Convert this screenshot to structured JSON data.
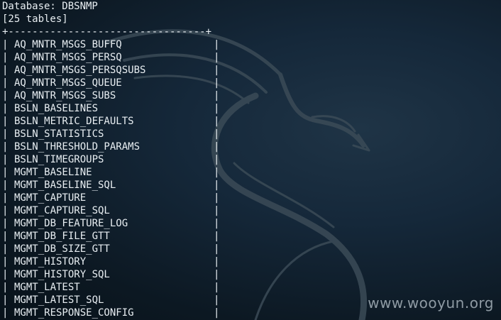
{
  "terminal": {
    "database_line": "Database: DBSNMP",
    "table_count_line": "[25 tables]",
    "border_top": "+---------------------------------+",
    "left_border_char": "|",
    "right_border_char": "|",
    "tables": [
      "AQ_MNTR_MSGS_BUFFQ",
      "AQ_MNTR_MSGS_PERSQ",
      "AQ_MNTR_MSGS_PERSQSUBS",
      "AQ_MNTR_MSGS_QUEUE",
      "AQ_MNTR_MSGS_SUBS",
      "BSLN_BASELINES",
      "BSLN_METRIC_DEFAULTS",
      "BSLN_STATISTICS",
      "BSLN_THRESHOLD_PARAMS",
      "BSLN_TIMEGROUPS",
      "MGMT_BASELINE",
      "MGMT_BASELINE_SQL",
      "MGMT_CAPTURE",
      "MGMT_CAPTURE_SQL",
      "MGMT_DB_FEATURE_LOG",
      "MGMT_DB_FILE_GTT",
      "MGMT_DB_SIZE_GTT",
      "MGMT_HISTORY",
      "MGMT_HISTORY_SQL",
      "MGMT_LATEST",
      "MGMT_LATEST_SQL",
      "MGMT_RESPONSE_CONFIG"
    ]
  },
  "watermark": "www.wooyun.org",
  "colors": {
    "text": "#e8eef2",
    "background": "#0e1b25",
    "dragon": "#3a4a56",
    "watermark": "#8e9aa3"
  },
  "icons": {
    "background_logo": "kali-dragon-icon"
  }
}
